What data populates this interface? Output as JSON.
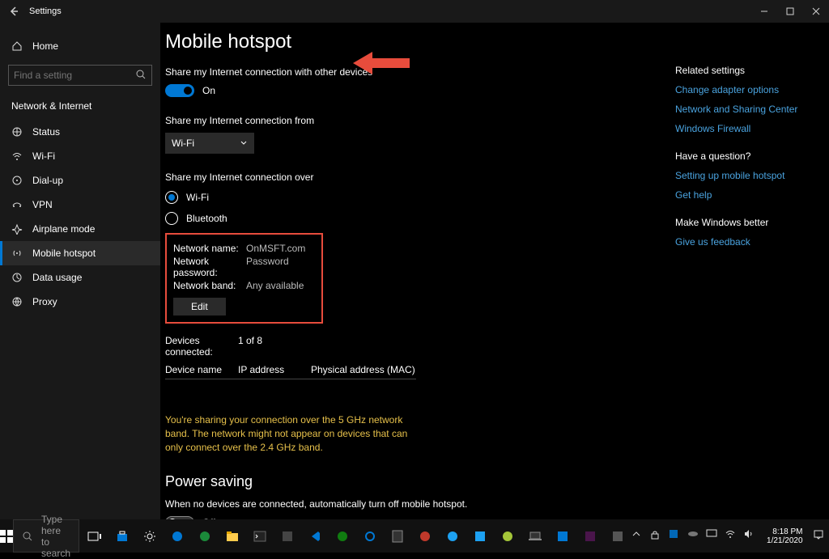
{
  "titlebar": {
    "title": "Settings"
  },
  "sidebar": {
    "home": "Home",
    "search_placeholder": "Find a setting",
    "section": "Network & Internet",
    "items": [
      {
        "label": "Status"
      },
      {
        "label": "Wi-Fi"
      },
      {
        "label": "Dial-up"
      },
      {
        "label": "VPN"
      },
      {
        "label": "Airplane mode"
      },
      {
        "label": "Mobile hotspot"
      },
      {
        "label": "Data usage"
      },
      {
        "label": "Proxy"
      }
    ]
  },
  "page": {
    "title": "Mobile hotspot",
    "share_label": "Share my Internet connection with other devices",
    "share_state": "On",
    "from_label": "Share my Internet connection from",
    "from_value": "Wi-Fi",
    "over_label": "Share my Internet connection over",
    "over_wifi": "Wi-Fi",
    "over_bt": "Bluetooth",
    "net": {
      "name_k": "Network name:",
      "name_v": "OnMSFT.com",
      "pass_k": "Network password:",
      "pass_v": "Password",
      "band_k": "Network band:",
      "band_v": "Any available",
      "edit": "Edit"
    },
    "devices_k": "Devices connected:",
    "devices_v": "1 of 8",
    "col1": "Device name",
    "col2": "IP address",
    "col3": "Physical address (MAC)",
    "note": "You're sharing your connection over the 5 GHz network band. The network might not appear on devices that can only connect over the 2.4 GHz band.",
    "power_h": "Power saving",
    "power_sub": "When no devices are connected, automatically turn off mobile hotspot.",
    "power_state": "Off"
  },
  "right": {
    "h1": "Related settings",
    "l1": "Change adapter options",
    "l2": "Network and Sharing Center",
    "l3": "Windows Firewall",
    "h2": "Have a question?",
    "l4": "Setting up mobile hotspot",
    "l5": "Get help",
    "h3": "Make Windows better",
    "l6": "Give us feedback"
  },
  "taskbar": {
    "search": "Type here to search",
    "time": "8:18 PM",
    "date": "1/21/2020"
  }
}
